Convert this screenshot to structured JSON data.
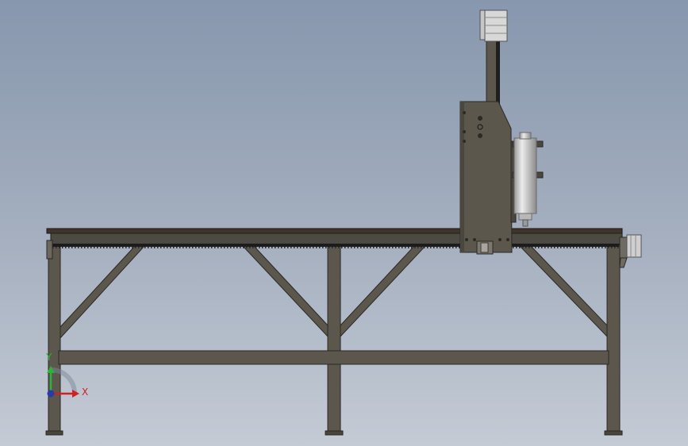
{
  "viewport": {
    "background_top": "#8797ad",
    "background_bottom": "#c4cbd5"
  },
  "model": {
    "frame_color": "#5b574c",
    "frame_edge": "#2a2823",
    "table_top_color": "#3e342a",
    "rack_color": "#1c1c1c",
    "spindle_color": "#d6d6d6"
  },
  "triad": {
    "y_label": "Y",
    "x_label": "X",
    "y_color": "#2db23a",
    "x_color": "#d02020",
    "z_color": "#2a3aa8"
  }
}
